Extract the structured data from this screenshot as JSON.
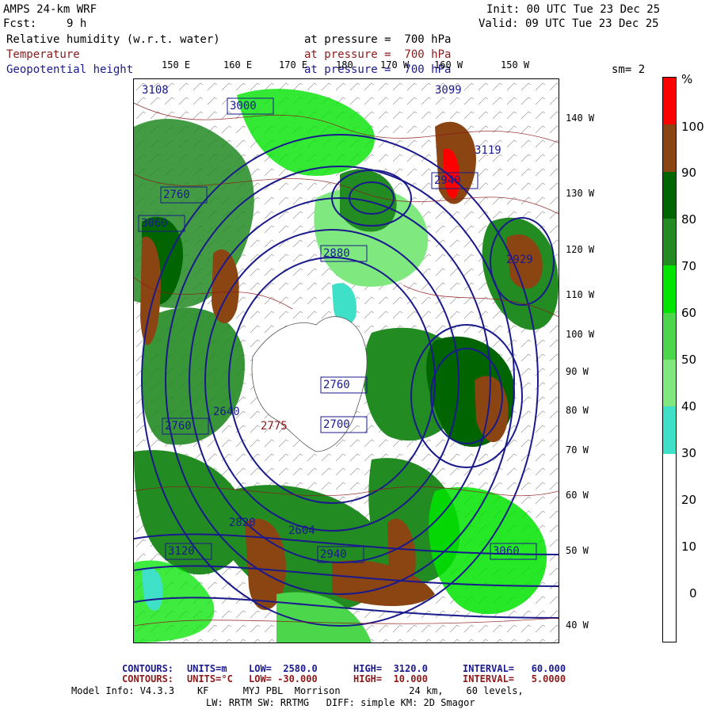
{
  "header": {
    "model": "AMPS 24-km WRF",
    "fcst_label": "Fcst:",
    "fcst_value": "9 h",
    "init": "Init: 00 UTC Tue 23 Dec 25",
    "valid": "Valid: 09 UTC Tue 23 Dec 25",
    "sm": "sm= 2"
  },
  "fields": [
    {
      "name": "Relative humidity (w.r.t. water)",
      "level": "at pressure =  700 hPa",
      "color": "#000000"
    },
    {
      "name": "Temperature",
      "level": "at pressure =  700 hPa",
      "color": "#8b1a1a"
    },
    {
      "name": "Geopotential height",
      "level": "at pressure =  700 hPa",
      "color": "#1a1a8c"
    }
  ],
  "lon_top": [
    "150 E",
    "160 E",
    "170 E",
    "180",
    "170 W",
    "160 W",
    "150 W"
  ],
  "lon_right": [
    "140 W",
    "130 W",
    "120 W",
    "110 W",
    "100 W",
    "90 W",
    "80 W",
    "70 W",
    "60 W",
    "50 W",
    "40 W"
  ],
  "colorbar": {
    "unit": "%",
    "labels": [
      "100",
      "90",
      "80",
      "70",
      "60",
      "50",
      "40",
      "30",
      "20",
      "10",
      "0"
    ],
    "segments": [
      {
        "color": "#ff0000"
      },
      {
        "color": "#8b4513"
      },
      {
        "color": "#006400"
      },
      {
        "color": "#228b22"
      },
      {
        "color": "#00e400"
      },
      {
        "color": "#4cd64c"
      },
      {
        "color": "#7fe87f"
      },
      {
        "color": "#3fe0c8"
      },
      {
        "color": "#ffffff"
      },
      {
        "color": "#ffffff"
      },
      {
        "color": "#ffffff"
      },
      {
        "color": "#ffffff"
      }
    ]
  },
  "height_labels": [
    {
      "text": "3000",
      "lon": "W",
      "note": ""
    },
    {
      "text": "2760"
    },
    {
      "text": "2880"
    },
    {
      "text": "3060"
    },
    {
      "text": "3120"
    },
    {
      "text": "2940"
    },
    {
      "text": "2700"
    },
    {
      "text": "2820"
    },
    {
      "text": "2640"
    },
    {
      "text": "3119"
    },
    {
      "text": "3108"
    },
    {
      "text": "3099"
    },
    {
      "text": "2929"
    },
    {
      "text": "2604"
    },
    {
      "text": "2775"
    }
  ],
  "footer": {
    "line1": {
      "label": "CONTOURS:",
      "units": "UNITS=m",
      "low": "LOW=  2580.0",
      "high": "HIGH=  3120.0",
      "interval": "INTERVAL=   60.000"
    },
    "line2": {
      "label": "CONTOURS:",
      "units": "UNITS=°C",
      "low": "LOW= -30.000",
      "high": "HIGH=  10.000",
      "interval": "INTERVAL=   5.0000"
    },
    "model_info": "Model Info: V4.3.3    KF      MYJ PBL  Morrison            24 km,    60 levels,",
    "model_info2": "LW: RRTM SW: RRTMG   DIFF: simple KM: 2D Smagor"
  }
}
